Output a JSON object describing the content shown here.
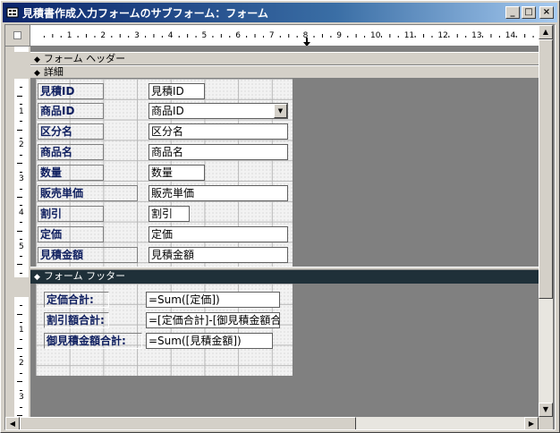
{
  "window": {
    "title": "見積書作成入力フォームのサブフォーム：フォーム",
    "icon": "form-icon",
    "controls": {
      "minimize": "_",
      "maximize": "□",
      "close": "×"
    }
  },
  "ruler": {
    "horizontal_numbers": [
      "1",
      "2",
      "3",
      "4",
      "5",
      "6",
      "7",
      "8",
      "9",
      "10",
      "11",
      "12",
      "13",
      "14",
      "1"
    ],
    "vertical_detail_numbers": [
      "1",
      "2",
      "3",
      "4",
      "5"
    ],
    "vertical_footer_numbers": [
      "1",
      "2",
      "3"
    ]
  },
  "sections": {
    "header": "フォーム ヘッダー",
    "detail": "詳細",
    "footer": "フォーム フッター"
  },
  "detail_controls": [
    {
      "label": "見積ID",
      "field": "見積ID"
    },
    {
      "label": "商品ID",
      "field": "商品ID",
      "combo": true
    },
    {
      "label": "区分名",
      "field": "区分名"
    },
    {
      "label": "商品名",
      "field": "商品名"
    },
    {
      "label": "数量",
      "field": "数量"
    },
    {
      "label": "販売単価",
      "field": "販売単価"
    },
    {
      "label": "割引",
      "field": "割引"
    },
    {
      "label": "定価",
      "field": "定価"
    },
    {
      "label": "見積金額",
      "field": "見積金額"
    }
  ],
  "footer_controls": [
    {
      "label": "定価合計:",
      "field": "=Sum([定価])"
    },
    {
      "label": "割引額合計:",
      "field": "=[定価合計]-[御見積金額合"
    },
    {
      "label": "御見積金額合計:",
      "field": "=Sum([見積金額])"
    }
  ],
  "colors": {
    "title_start": "#0a246a",
    "title_end": "#a6caf0",
    "footer_band": "#1f3039",
    "label_text": "#102060",
    "workspace": "#808080"
  }
}
